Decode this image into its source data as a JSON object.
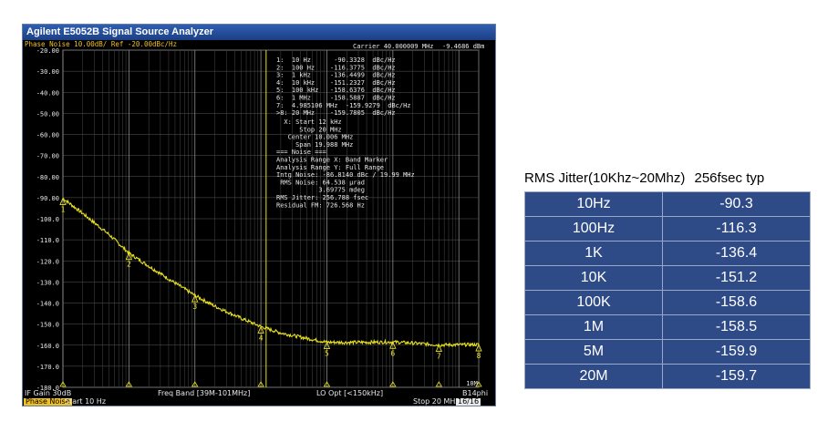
{
  "window": {
    "title": "Agilent E5052B Signal Source Analyzer"
  },
  "plot_header": {
    "trace_label": "Phase Noise 10.00dB/ Ref -20.00dBc/Hz",
    "carrier": "Carrier 40.000009 MHz",
    "carrier_power": "-9.4686 dBm"
  },
  "markers_readout": [
    "1:  10 Hz      -90.3328  dBc/Hz",
    "2:  100 Hz    -116.3775  dBc/Hz",
    "3:  1 kHz     -136.4499  dBc/Hz",
    "4:  10 kHz    -151.2327  dBc/Hz",
    "5:  100 kHz   -158.6376  dBc/Hz",
    "6:  1 MHz     -158.5887  dBc/Hz",
    "7:  4.985106 MHz  -159.9279  dBc/Hz",
    ">8: 20 MHz    -159.7805  dBc/Hz"
  ],
  "analysis_readout": [
    "  X: Start 12 kHz",
    "      Stop 20 MHz",
    "   Center 10.006 MHz",
    "     Span 19.988 MHz",
    "=== Noise ===",
    "Analysis Range X: Band Marker",
    "Analysis Range Y: Full Range",
    "Intg Noise: -86.8140 dBc / 19.99 MHz",
    " RMS Noise: 64.538 µrad",
    "           3.69775 mdeg",
    "RMS Jitter: 256.788 fsec",
    "Residual FM: 726.568 Hz"
  ],
  "status": {
    "if_gain": "IF Gain 30dB",
    "freq_band": "Freq Band [39M-101MHz]",
    "lo_opt": "LO Opt [<150kHz]",
    "mode": "Phase Noise",
    "start": "Start 10 Hz",
    "stop": "Stop 20 MHz",
    "pages": "16/16",
    "corner": "B14phi"
  },
  "jitter_table": {
    "title": "RMS Jitter(10Khz~20Mhz)",
    "subtitle": "256fsec typ",
    "rows": [
      [
        "10Hz",
        "-90.3"
      ],
      [
        "100Hz",
        "-116.3"
      ],
      [
        "1K",
        "-136.4"
      ],
      [
        "10K",
        "-151.2"
      ],
      [
        "100K",
        "-158.6"
      ],
      [
        "1M",
        "-158.5"
      ],
      [
        "5M",
        "-159.9"
      ],
      [
        "20M",
        "-159.7"
      ]
    ]
  },
  "chart_data": {
    "type": "line",
    "xscale": "log",
    "xlim": [
      10,
      20000000
    ],
    "ylim": [
      -160,
      -20
    ],
    "ylabel_ticks": [
      "-20.00",
      "-30.00",
      "-40.00",
      "-50.00",
      "-60.00",
      "-70.00",
      "-80.00",
      "-90.00",
      "-100.0",
      "-110.0",
      "-120.0",
      "-130.0",
      "-140.0",
      "-150.0",
      "-160.0",
      "-170.0",
      "-180.0"
    ],
    "yticks": [
      -20,
      -30,
      -40,
      -50,
      -60,
      -70,
      -80,
      -90,
      -100,
      -110,
      -120,
      -130,
      -140,
      -150,
      -160,
      -170,
      -180
    ],
    "x_tick_label": "10M",
    "x": [
      10,
      20,
      50,
      100,
      200,
      500,
      1000,
      2000,
      5000,
      10000,
      20000,
      50000,
      100000,
      200000,
      500000,
      1000000,
      2000000,
      5000000,
      10000000,
      20000000
    ],
    "values": [
      -90.3,
      -97.5,
      -107.5,
      -116.3,
      -122.5,
      -130.5,
      -136.4,
      -141.5,
      -147.2,
      -151.2,
      -154.2,
      -156.8,
      -158.6,
      -158.7,
      -158.6,
      -158.5,
      -159.0,
      -159.9,
      -159.8,
      -159.7
    ],
    "markers": [
      {
        "label": "1",
        "x": 10,
        "y": -90.3
      },
      {
        "label": "2",
        "x": 100,
        "y": -116.3
      },
      {
        "label": "3",
        "x": 1000,
        "y": -136.4
      },
      {
        "label": "4",
        "x": 10000,
        "y": -151.2
      },
      {
        "label": "5",
        "x": 100000,
        "y": -158.6
      },
      {
        "label": "6",
        "x": 1000000,
        "y": -158.5
      },
      {
        "label": "7",
        "x": 4985106,
        "y": -159.9
      },
      {
        "label": "8",
        "x": 20000000,
        "y": -159.7
      }
    ],
    "band_marker_x": 12000,
    "line_color": "#e8e020",
    "grid": true
  }
}
